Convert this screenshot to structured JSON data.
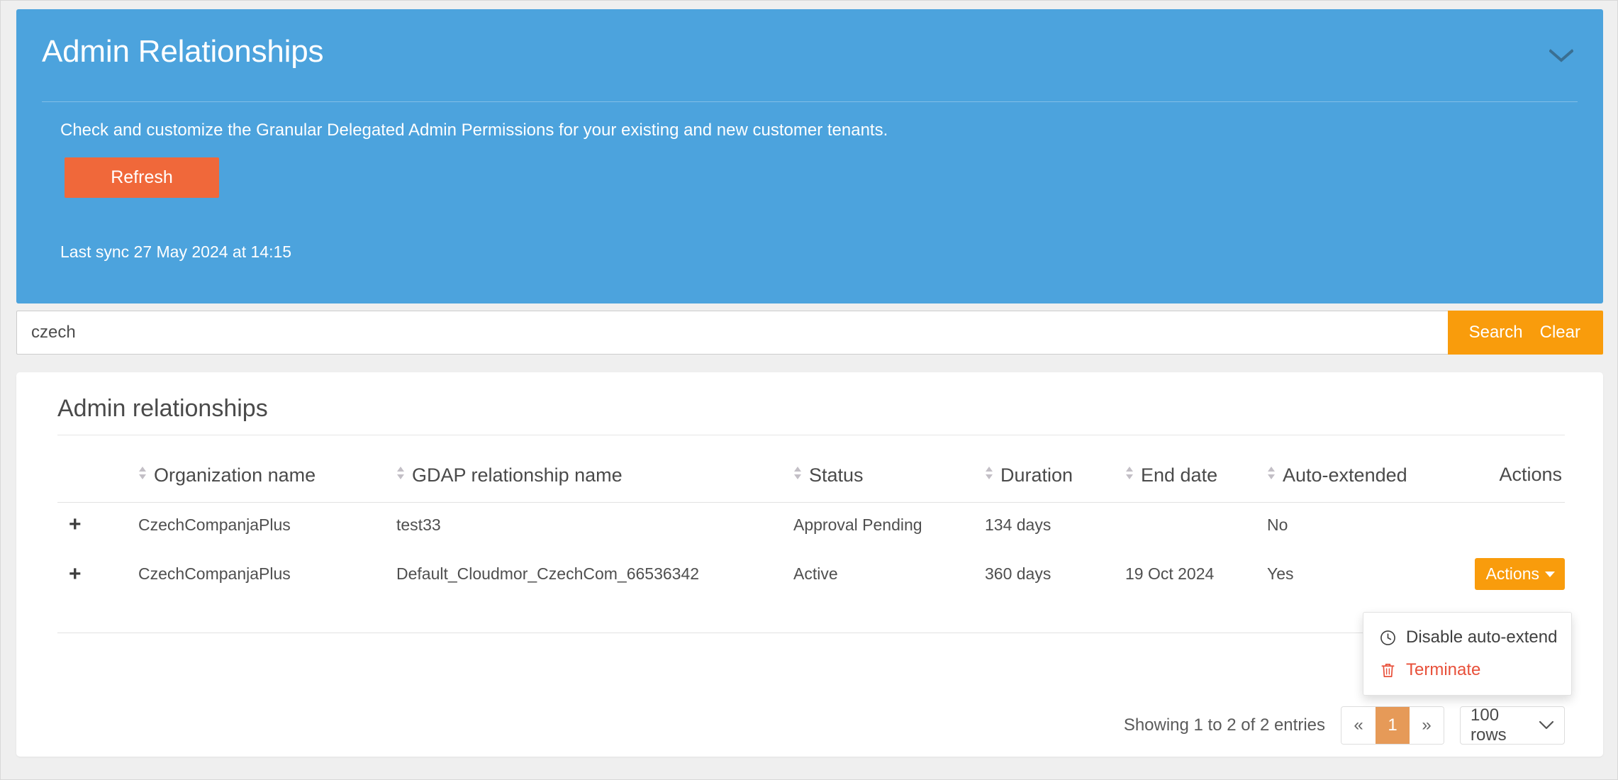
{
  "panel": {
    "title": "Admin Relationships",
    "description": "Check and customize the Granular Delegated Admin Permissions for your existing and new customer tenants.",
    "refresh_label": "Refresh",
    "last_sync": "Last sync 27 May 2024 at 14:15",
    "collapse_icon": "chevron-down-icon",
    "background_color": "#4ca3dd",
    "refresh_color": "#f0683a"
  },
  "search": {
    "value": "czech",
    "placeholder": "",
    "search_label": "Search",
    "clear_label": "Clear",
    "button_color": "#f99c0c"
  },
  "table": {
    "title": "Admin relationships",
    "columns": [
      {
        "label": "",
        "sortable": false
      },
      {
        "label": "Organization name",
        "sortable": true
      },
      {
        "label": "GDAP relationship name",
        "sortable": true
      },
      {
        "label": "Status",
        "sortable": true
      },
      {
        "label": "Duration",
        "sortable": true
      },
      {
        "label": "End date",
        "sortable": true
      },
      {
        "label": "Auto-extended",
        "sortable": true
      },
      {
        "label": "Actions",
        "sortable": false
      }
    ],
    "rows": [
      {
        "expand": "+",
        "organization": "CzechCompanjaPlus",
        "gdap_name": "test33",
        "status": "Approval Pending",
        "duration": "134 days",
        "end_date": "",
        "auto_extended": "No",
        "actions_label": ""
      },
      {
        "expand": "+",
        "organization": "CzechCompanjaPlus",
        "gdap_name": "Default_Cloudmor_CzechCom_66536342",
        "status": "Active",
        "duration": "360 days",
        "end_date": "19 Oct 2024",
        "auto_extended": "Yes",
        "actions_label": "Actions"
      }
    ]
  },
  "dropdown": {
    "items": [
      {
        "label": "Disable auto-extend",
        "icon": "clock-icon",
        "danger": false
      },
      {
        "label": "Terminate",
        "icon": "trash-icon",
        "danger": true
      }
    ],
    "danger_color": "#e8503a"
  },
  "footer": {
    "entries_info": "Showing 1 to 2 of 2 entries",
    "pager": {
      "first_label": "«",
      "pages": [
        "1"
      ],
      "last_label": "»",
      "active_page": "1",
      "active_color": "#e69a58"
    },
    "rows_per_page": "100 rows",
    "rows_icon": "chevron-down-icon"
  }
}
